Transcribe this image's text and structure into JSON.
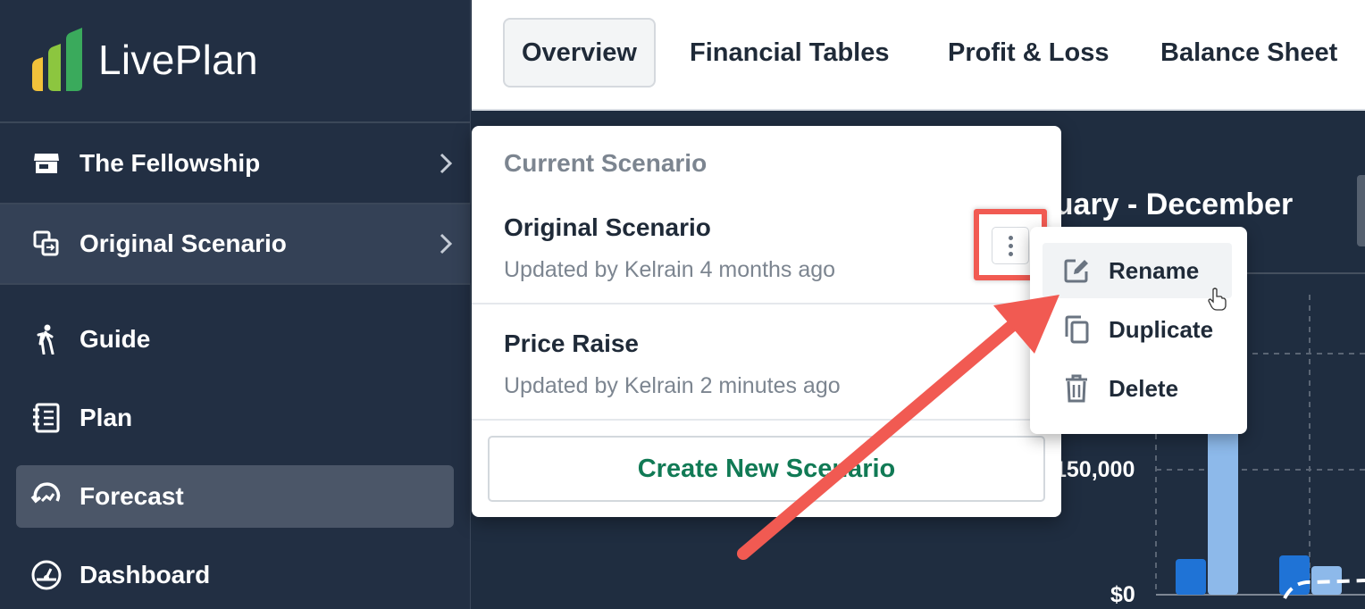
{
  "app": {
    "brand": "LivePlan",
    "accent_color": "#117a55",
    "highlight_color": "#f15a52"
  },
  "sidebar": {
    "company": {
      "label": "The Fellowship",
      "icon": "store-icon"
    },
    "scenario": {
      "label": "Original Scenario",
      "icon": "scenario-swap-icon"
    },
    "nav": [
      {
        "label": "Guide",
        "icon": "hiker-icon",
        "selected": false
      },
      {
        "label": "Plan",
        "icon": "notebook-icon",
        "selected": false
      },
      {
        "label": "Forecast",
        "icon": "forecast-icon",
        "selected": true
      },
      {
        "label": "Dashboard",
        "icon": "dashboard-gauge-icon",
        "selected": false
      }
    ]
  },
  "tabs": [
    {
      "label": "Overview",
      "active": true
    },
    {
      "label": "Financial Tables",
      "active": false
    },
    {
      "label": "Profit & Loss",
      "active": false
    },
    {
      "label": "Balance Sheet",
      "active": false
    }
  ],
  "background": {
    "period_title": "nuary - December",
    "axis_labels": [
      "150,000",
      "$0"
    ]
  },
  "scenario_menu": {
    "heading": "Current Scenario",
    "scenarios": [
      {
        "name": "Original Scenario",
        "meta": "Updated by Kelrain 4 months ago",
        "current": true
      },
      {
        "name": "Price Raise",
        "meta": "Updated by Kelrain 2 minutes ago",
        "current": false
      }
    ],
    "create_label": "Create New Scenario"
  },
  "context_menu": {
    "items": [
      {
        "label": "Rename",
        "icon": "edit-icon",
        "hover": true
      },
      {
        "label": "Duplicate",
        "icon": "copy-icon",
        "hover": false
      },
      {
        "label": "Delete",
        "icon": "trash-icon",
        "hover": false
      }
    ]
  }
}
